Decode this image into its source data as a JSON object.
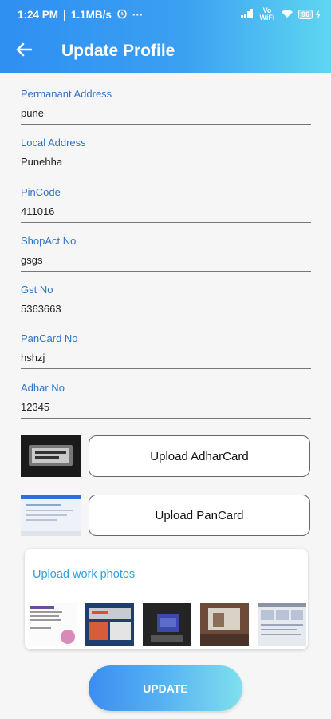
{
  "status_bar": {
    "time": "1:24 PM",
    "speed": "1.1MB/s",
    "extra": "···",
    "volte": "Vo WiFi",
    "battery": "96"
  },
  "app_bar": {
    "title": "Update Profile"
  },
  "form": {
    "fields": [
      {
        "label": "Permanant Address",
        "value": "pune"
      },
      {
        "label": "Local Address",
        "value": "Punehha"
      },
      {
        "label": "PinCode",
        "value": "411016"
      },
      {
        "label": "ShopAct No",
        "value": "gsgs"
      },
      {
        "label": "Gst No",
        "value": "5363663"
      },
      {
        "label": "PanCard No",
        "value": "hshzj"
      },
      {
        "label": "Adhar No",
        "value": "12345"
      }
    ]
  },
  "documents": {
    "adhar_button": "Upload AdharCard",
    "pan_button": "Upload PanCard"
  },
  "work_photos": {
    "title": "Upload work photos"
  },
  "actions": {
    "update_label": "UPDATE"
  },
  "colors": {
    "accent": "#2f8ff2",
    "label": "#2f74c9",
    "card_title": "#2fa0e6"
  }
}
